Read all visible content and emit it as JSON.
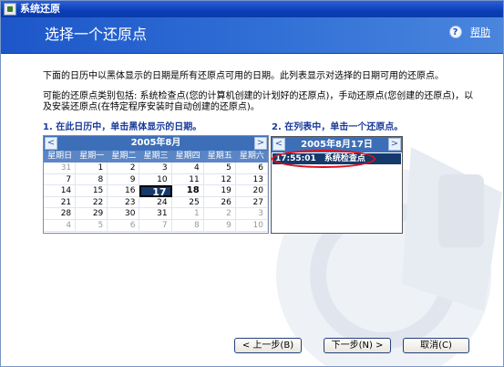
{
  "window": {
    "title": "系统还原"
  },
  "banner": {
    "title": "选择一个还原点",
    "help_label": "帮助",
    "help_icon": "?"
  },
  "intro": {
    "line1": "下面的日历中以黑体显示的日期是所有还原点可用的日期。此列表显示对选择的日期可用的还原点。",
    "line2": "可能的还原点类别包括: 系统检查点(您的计算机创建的计划好的还原点)，手动还原点(您创建的还原点)，以及安装还原点(在特定程序安装时自动创建的还原点)。"
  },
  "step1": {
    "label": "1. 在此日历中，单击黑体显示的日期。"
  },
  "step2": {
    "label": "2. 在列表中，单击一个还原点。"
  },
  "calendar": {
    "month_label": "2005年8月",
    "prev_glyph": "<",
    "next_glyph": ">",
    "weekdays": [
      "星期日",
      "星期一",
      "星期二",
      "星期三",
      "星期四",
      "星期五",
      "星期六"
    ],
    "days": [
      {
        "d": "31",
        "out": true
      },
      {
        "d": "1"
      },
      {
        "d": "2"
      },
      {
        "d": "3"
      },
      {
        "d": "4"
      },
      {
        "d": "5"
      },
      {
        "d": "6"
      },
      {
        "d": "7"
      },
      {
        "d": "8"
      },
      {
        "d": "9"
      },
      {
        "d": "10"
      },
      {
        "d": "11"
      },
      {
        "d": "12"
      },
      {
        "d": "13"
      },
      {
        "d": "14"
      },
      {
        "d": "15"
      },
      {
        "d": "16"
      },
      {
        "d": "17",
        "selected": true
      },
      {
        "d": "18",
        "bold": true
      },
      {
        "d": "19"
      },
      {
        "d": "20"
      },
      {
        "d": "21"
      },
      {
        "d": "22"
      },
      {
        "d": "23"
      },
      {
        "d": "24"
      },
      {
        "d": "25"
      },
      {
        "d": "26"
      },
      {
        "d": "27"
      },
      {
        "d": "28"
      },
      {
        "d": "29"
      },
      {
        "d": "30"
      },
      {
        "d": "31"
      },
      {
        "d": "1",
        "out": true
      },
      {
        "d": "2",
        "out": true
      },
      {
        "d": "3",
        "out": true
      },
      {
        "d": "4",
        "out": true
      },
      {
        "d": "5",
        "out": true
      },
      {
        "d": "6",
        "out": true
      },
      {
        "d": "7",
        "out": true
      },
      {
        "d": "8",
        "out": true
      },
      {
        "d": "9",
        "out": true
      },
      {
        "d": "10",
        "out": true
      }
    ]
  },
  "restore_list": {
    "date_label": "2005年8月17日",
    "prev_glyph": "<",
    "next_glyph": ">",
    "items": [
      {
        "time": "17:55:01",
        "name": "系统检查点"
      }
    ]
  },
  "buttons": {
    "back": "< 上一步(B)",
    "next": "下一步(N) >",
    "cancel": "取消(C)"
  }
}
